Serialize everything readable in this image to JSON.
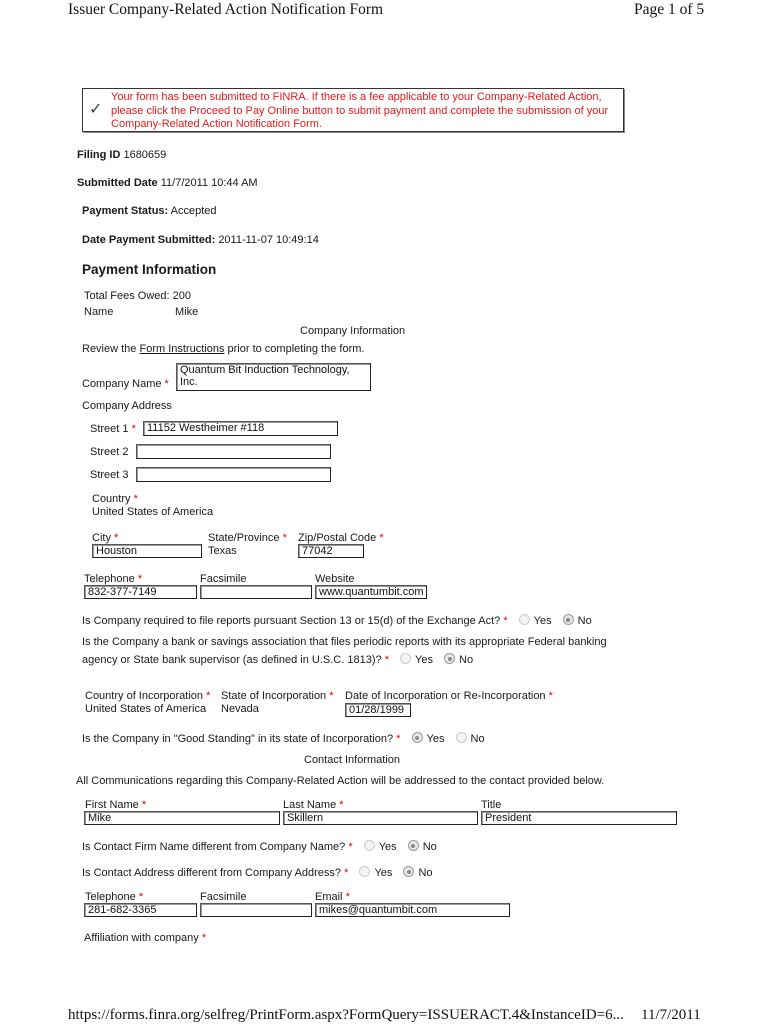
{
  "page_header": {
    "title": "Issuer Company-Related Action Notification Form",
    "page": "Page 1 of 5"
  },
  "notice": {
    "icon": "checkmark-icon",
    "text": "Your form has been submitted to FINRA. If there is a fee applicable to your Company-Related Action, please click the Proceed to Pay Online button to submit payment and complete the submission of your Company-Related Action Notification Form."
  },
  "filing": {
    "filing_id_label": "Filing ID",
    "filing_id": "1680659",
    "submitted_date_label": "Submitted Date",
    "submitted_date": "11/7/2011 10:44 AM",
    "payment_status_label": "Payment Status:",
    "payment_status": "Accepted",
    "date_payment_label": "Date Payment Submitted:",
    "date_payment": "2011-11-07 10:49:14"
  },
  "payment": {
    "heading": "Payment Information",
    "total_fees_label": "Total Fees Owed:",
    "total_fees": "200",
    "name_label": "Name",
    "name": "Mike"
  },
  "company": {
    "section_title": "Company Information",
    "review_prefix": "Review the ",
    "review_link": "Form Instructions",
    "review_suffix": " prior to completing the form.",
    "name_label": "Company Name",
    "name_line1": "Quantum Bit Induction Technology,",
    "name_line2": "Inc.",
    "address_label": "Company Address",
    "street1_label": "Street 1",
    "street1": "11152 Westheimer #118",
    "street2_label": "Street 2",
    "street2": "",
    "street3_label": "Street 3",
    "street3": "",
    "country_label": "Country",
    "country": "United States of America",
    "city_label": "City",
    "city": "Houston",
    "state_label": "State/Province",
    "state": "Texas",
    "zip_label": "Zip/Postal Code",
    "zip": "77042",
    "telephone_label": "Telephone",
    "telephone": "832-377-7149",
    "fax_label": "Facsimile",
    "fax": "",
    "website_label": "Website",
    "website": "www.quantumbit.com",
    "required_mark": "*"
  },
  "questions": [
    {
      "text": "Is Company required to file reports pursuant Section 13 or 15(d) of the Exchange Act?",
      "yes": "Yes",
      "no": "No",
      "selected": "No"
    },
    {
      "text_line1": "Is the Company a bank or savings association that files periodic reports with its appropriate Federal banking",
      "text_line2": "agency or State bank supervisor (as defined in U.S.C. 1813)?",
      "yes": "Yes",
      "no": "No",
      "selected": "No"
    },
    {
      "text": "Is the Company in \"Good Standing\" in its state of Incorporation?",
      "yes": "Yes",
      "no": "No",
      "selected": "Yes"
    },
    {
      "text": "Is Contact Firm Name different from Company Name?",
      "yes": "Yes",
      "no": "No",
      "selected": "No"
    },
    {
      "text": "Is Contact Address different from Company Address?",
      "yes": "Yes",
      "no": "No",
      "selected": "No"
    }
  ],
  "incorporation": {
    "country_label": "Country of Incorporation",
    "country": "United States of America",
    "state_label": "State of Incorporation",
    "state": "Nevada",
    "date_label": "Date of Incorporation or Re-Incorporation",
    "date": "01/28/1999"
  },
  "contact": {
    "section_title": "Contact Information",
    "note": "All Communications regarding this Company-Related Action will be addressed to the contact provided below.",
    "first_name_label": "First Name",
    "first_name": "Mike",
    "last_name_label": "Last Name",
    "last_name": "Skillern",
    "title_label": "Title",
    "title": "President",
    "telephone_label": "Telephone",
    "telephone": "281-682-3365",
    "fax_label": "Facsimile",
    "fax": "",
    "email_label": "Email",
    "email": "mikes@quantumbit.com",
    "affiliation_label": "Affiliation with company"
  },
  "page_footer": {
    "url": "https://forms.finra.org/selfreg/PrintForm.aspx?FormQuery=ISSUERACT.4&InstanceID=6...",
    "date": "11/7/2011"
  }
}
